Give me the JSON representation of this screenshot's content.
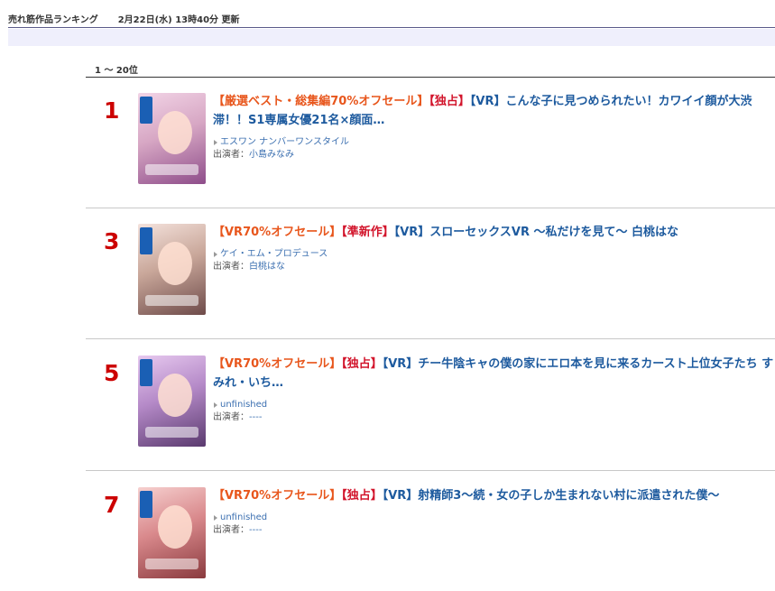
{
  "header": {
    "title": "売れ筋作品ランキング",
    "updated": "2月22日(水) 13時40分 更新"
  },
  "range_label": "1 ～ 20位",
  "items": [
    {
      "rank": "1",
      "tags": [
        "【厳選ベスト・総集編70%オフセール】",
        "【独占】",
        "【VR】"
      ],
      "title": "こんな子に見つめられたい！カワイイ顔が大渋滞！！S1専属女優21名×顔面…",
      "maker": "エスワン ナンバーワンスタイル",
      "actors_label": "出演者：",
      "actors": "小島みなみ",
      "thumb_colors": [
        "#d7a7c4",
        "#8e4d8a",
        "#f2d4e6"
      ]
    },
    {
      "rank": "3",
      "tags": [
        "【VR70%オフセール】",
        "【準新作】",
        "【VR】"
      ],
      "title": "スローセックスVR ～私だけを見て～ 白桃はな",
      "maker": "ケイ・エム・プロデュース",
      "actors_label": "出演者：",
      "actors": "白桃はな",
      "thumb_colors": [
        "#c9a79a",
        "#6e4b4a",
        "#f4e2dc"
      ]
    },
    {
      "rank": "5",
      "tags": [
        "【VR70%オフセール】",
        "【独占】",
        "【VR】"
      ],
      "title": "チー牛陰キャの僕の家にエロ本を見に来るカースト上位女子たち すみれ・いち…",
      "maker": "unfinished",
      "actors_label": "出演者：",
      "actors": "----",
      "thumb_colors": [
        "#b58ac8",
        "#5a3a6e",
        "#e7c9ef"
      ]
    },
    {
      "rank": "7",
      "tags": [
        "【VR70%オフセール】",
        "【独占】",
        "【VR】"
      ],
      "title": "射精師3～続・女の子しか生まれない村に派遣された僕～",
      "maker": "unfinished",
      "actors_label": "出演者：",
      "actors": "----",
      "thumb_colors": [
        "#d9898c",
        "#8a3a3e",
        "#f6d0cf"
      ]
    }
  ]
}
